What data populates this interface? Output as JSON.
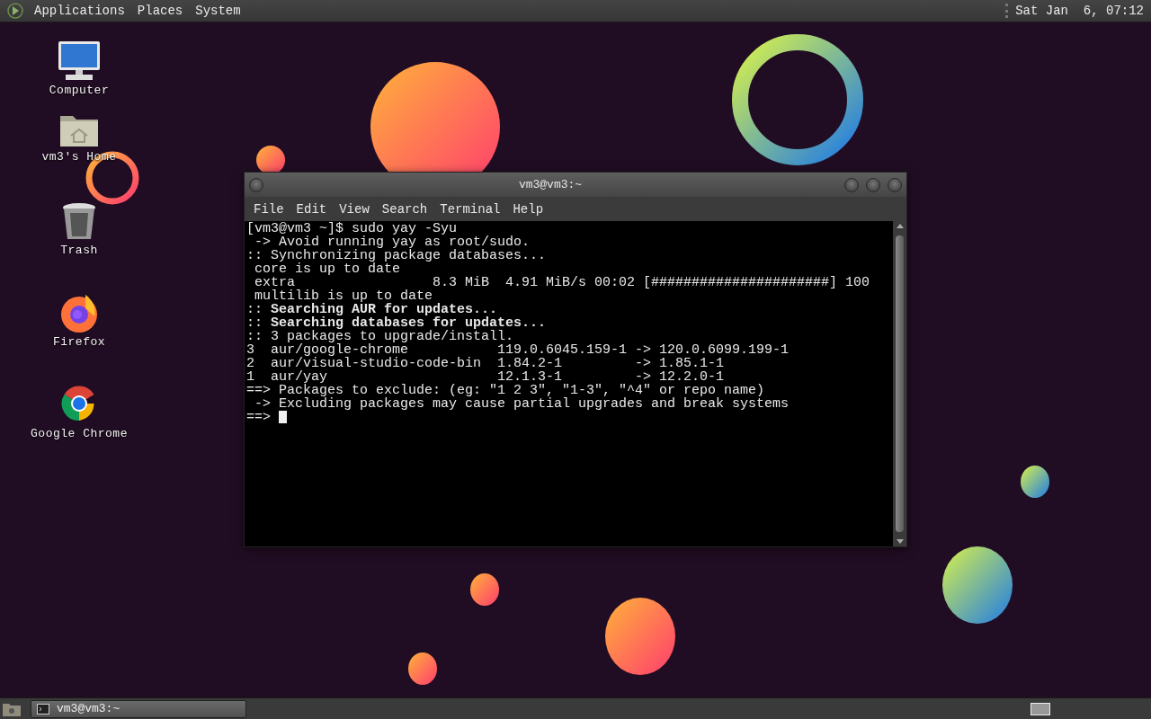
{
  "top_panel": {
    "menus": [
      "Applications",
      "Places",
      "System"
    ],
    "clock": "Sat Jan  6, 07:12"
  },
  "desktop_icons": [
    {
      "label": "Computer",
      "kind": "computer"
    },
    {
      "label": "vm3's Home",
      "kind": "home"
    },
    {
      "label": "Trash",
      "kind": "trash"
    },
    {
      "label": "Firefox",
      "kind": "firefox"
    },
    {
      "label": "Google Chrome",
      "kind": "chrome"
    }
  ],
  "terminal_window": {
    "title": "vm3@vm3:~",
    "menus": [
      "File",
      "Edit",
      "View",
      "Search",
      "Terminal",
      "Help"
    ],
    "lines": [
      "[vm3@vm3 ~]$ sudo yay -Syu",
      " -> Avoid running yay as root/sudo.",
      ":: Synchronizing package databases...",
      " core is up to date",
      " extra                 8.3 MiB  4.91 MiB/s 00:02 [######################] 100",
      " multilib is up to date",
      ":: **Searching AUR for updates...**",
      ":: **Searching databases for updates...**",
      ":: 3 packages to upgrade/install.",
      "3  aur/google-chrome           119.0.6045.159-1 -> 120.0.6099.199-1",
      "2  aur/visual-studio-code-bin  1.84.2-1         -> 1.85.1-1",
      "1  aur/yay                     12.1.3-1         -> 12.2.0-1",
      "==> Packages to exclude: (eg: \"1 2 3\", \"1-3\", \"^4\" or repo name)",
      " -> Excluding packages may cause partial upgrades and break systems",
      "==> "
    ]
  },
  "taskbar": {
    "tasks": [
      {
        "label": "vm3@vm3:~",
        "selected": true
      }
    ]
  }
}
